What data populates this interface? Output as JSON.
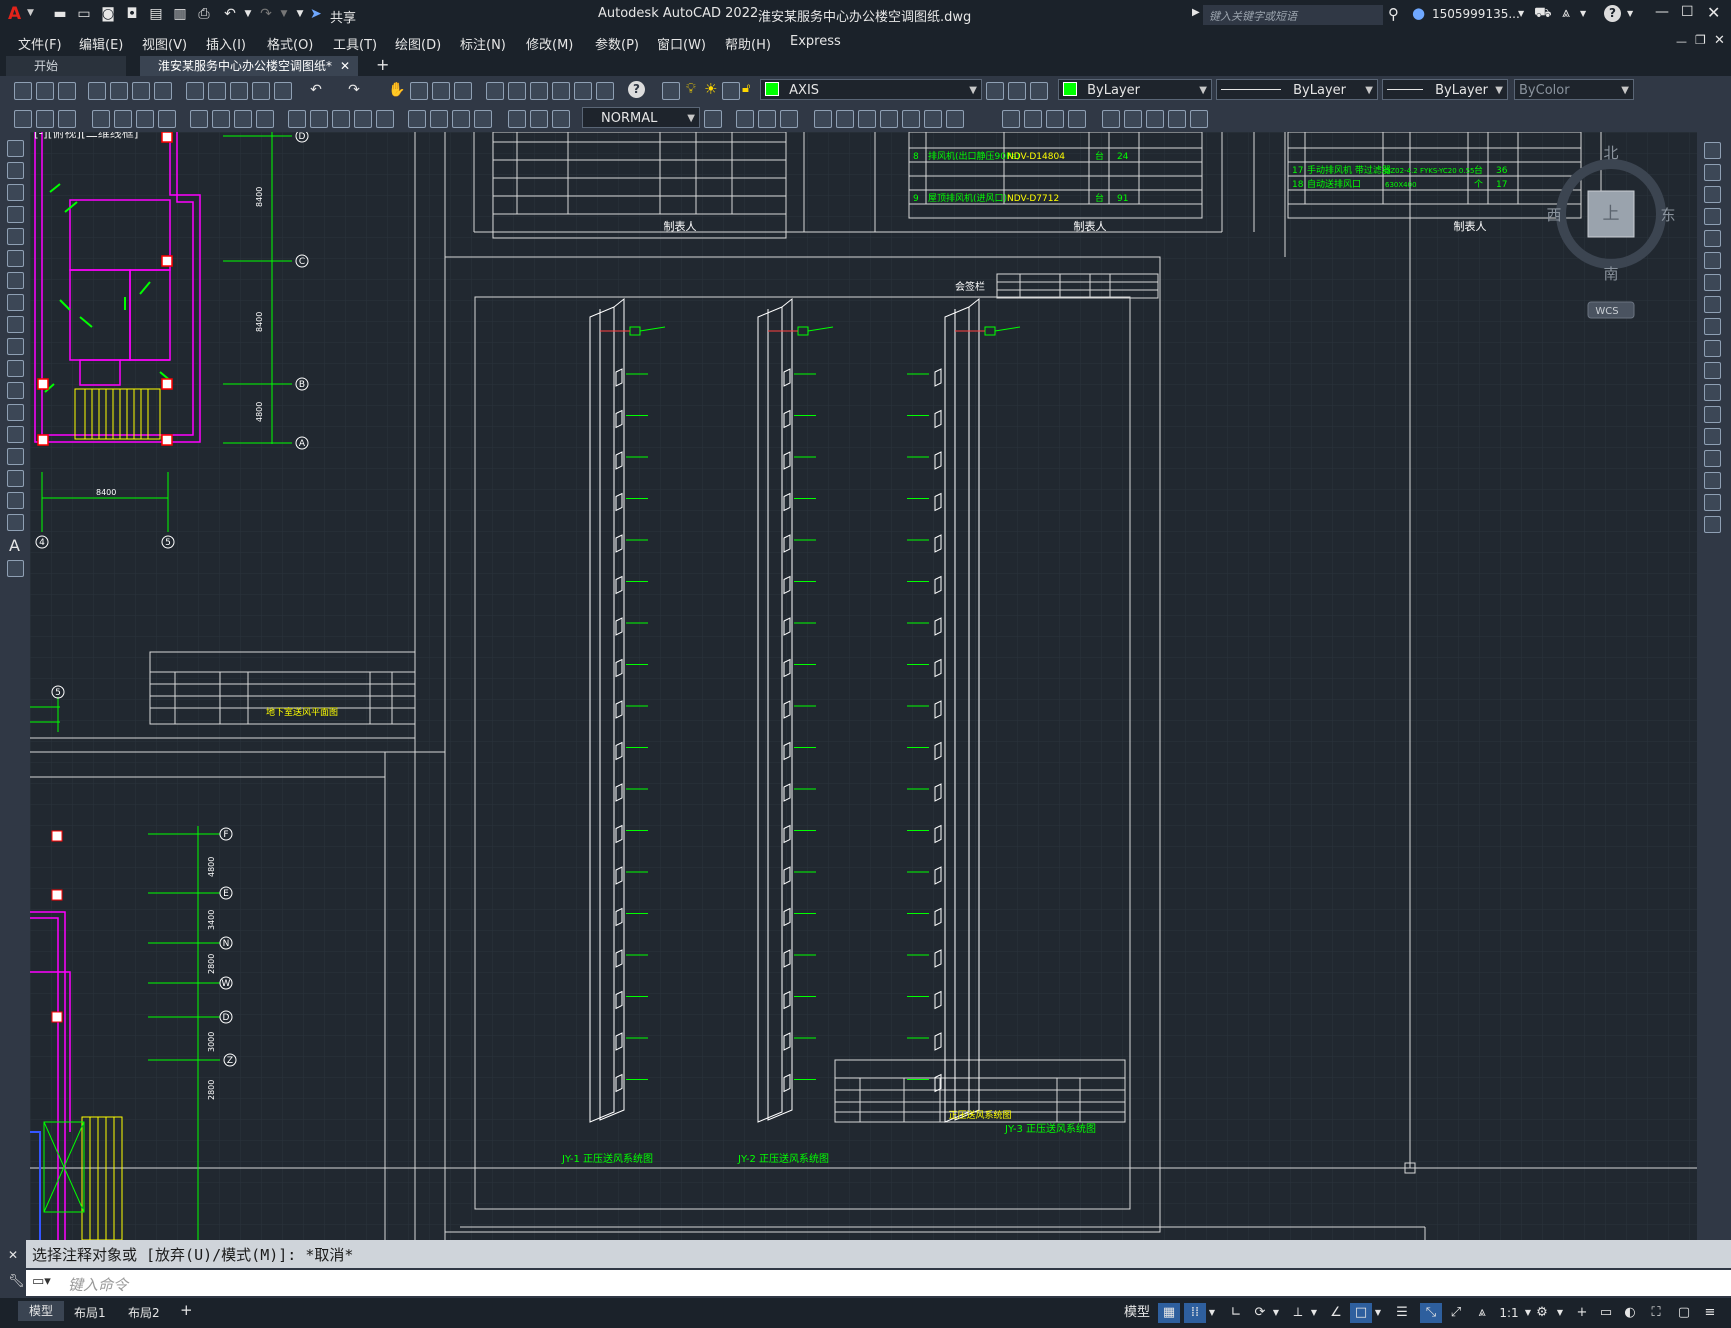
{
  "app": {
    "title": "Autodesk AutoCAD 2022",
    "file_name": "淮安某服务中心办公楼空调图纸.dwg",
    "share_label": "共享",
    "search_placeholder": "键入关键字或短语",
    "user": "1505999135...",
    "help_icon": "?"
  },
  "menu": {
    "items": [
      "文件(F)",
      "编辑(E)",
      "视图(V)",
      "插入(I)",
      "格式(O)",
      "工具(T)",
      "绘图(D)",
      "标注(N)",
      "修改(M)",
      "参数(P)",
      "窗口(W)",
      "帮助(H)",
      "Express"
    ]
  },
  "doc_tabs": {
    "start": "开始",
    "active": "淮安某服务中心办公楼空调图纸*",
    "add": "+"
  },
  "toolbar": {
    "layer_name": "AXIS",
    "color": "ByLayer",
    "linetype": "ByLayer",
    "lineweight": "ByLayer",
    "plotstyle": "ByColor",
    "dimstyle": "NORMAL"
  },
  "viewport": {
    "label": "[-][俯视][二维线框]"
  },
  "viewcube": {
    "north": "北",
    "south": "南",
    "east": "东",
    "west": "西",
    "top": "上",
    "wcs": "WCS"
  },
  "drawing": {
    "table_footer": "制表人",
    "table_right_rows": [
      {
        "no": "17",
        "name": "手动排风机 带过滤器",
        "spec": "DZ02-4.2 FYKS-YC20 0.55",
        "unit": "台",
        "qty": "36"
      },
      {
        "no": "18",
        "name": "自动送排风口",
        "spec": "630X400",
        "unit": "个",
        "qty": "17"
      }
    ],
    "table_mid_rows": [
      {
        "no": "8",
        "name": "排风机(出口静压90Pa)",
        "spec": "NDV-D14804",
        "unit": "台",
        "qty": "24"
      },
      {
        "no": "9",
        "name": "屋顶排风机(进风口)",
        "spec": "NDV-D7712",
        "unit": "台",
        "qty": "91"
      }
    ],
    "riser_labels": [
      "JY-1 正压送风系统图",
      "JY-2 正压送风系统图",
      "JY-3 正压送风系统图"
    ],
    "sheet_title_left": "地下室送风平面图",
    "sheet_title_mid": "正压送风系统图",
    "axis_bubbles_top": [
      "D",
      "C",
      "B",
      "A"
    ],
    "axis_dims_top": [
      "8400",
      "8400",
      "4800"
    ],
    "axis_bottom": [
      "4",
      "5"
    ],
    "dim_bottom": "8400",
    "axis_bubbles_lower": [
      "F",
      "E",
      "N",
      "W",
      "D",
      "Z"
    ],
    "axis_dims_lower": [
      "4800",
      "3400",
      "2800",
      "3000",
      "2800"
    ],
    "lower_bubble": "5",
    "label_top_small": "会签栏"
  },
  "command": {
    "history": "选择注释对象或 [放弃(U)/模式(M)]: *取消*",
    "placeholder": "键入命令"
  },
  "status": {
    "tabs": [
      "模型",
      "布局1",
      "布局2"
    ],
    "add": "+",
    "model_btn": "模型",
    "scale": "1:1"
  },
  "colors": {
    "accent_green": "#00ff00",
    "magenta": "#ff00ff",
    "yellow": "#ffff00",
    "white_line": "#ffffff",
    "bg": "#212830"
  }
}
